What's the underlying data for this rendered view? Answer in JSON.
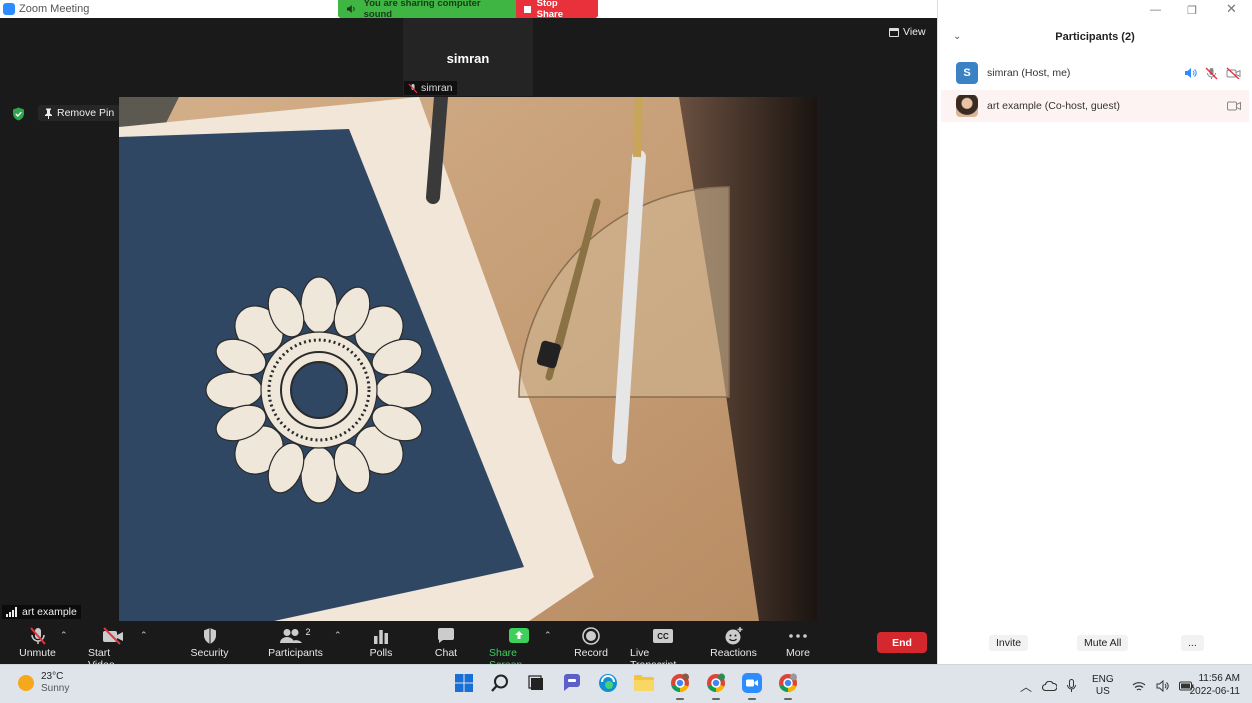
{
  "window": {
    "title": "Zoom Meeting"
  },
  "share_banner": {
    "status": "You are sharing computer sound",
    "stop_label": "Stop Share"
  },
  "video": {
    "top_tile_name": "simran",
    "top_tile_label": "simran",
    "view_label": "View",
    "remove_pin_label": "Remove Pin",
    "main_label": "art example"
  },
  "toolbar": {
    "unmute": "Unmute",
    "start_video": "Start Video",
    "security": "Security",
    "participants": "Participants",
    "participants_count": "2",
    "polls": "Polls",
    "chat": "Chat",
    "share_screen": "Share Screen",
    "record": "Record",
    "live_transcript": "Live Transcript",
    "reactions": "Reactions",
    "more": "More",
    "end": "End",
    "colors": {
      "share_green": "#3fd05c",
      "end_red": "#d5282e"
    }
  },
  "participants_panel": {
    "title": "Participants (2)",
    "participants": [
      {
        "initial": "S",
        "name": "simran (Host, me)"
      },
      {
        "name": "art example (Co-host, guest)"
      }
    ],
    "invite": "Invite",
    "mute_all": "Mute All",
    "more": "..."
  },
  "taskbar": {
    "weather_temp": "23°C",
    "weather_desc": "Sunny",
    "lang_top": "ENG",
    "lang_bottom": "US",
    "time": "11:56 AM",
    "date": "2022-06-11"
  }
}
